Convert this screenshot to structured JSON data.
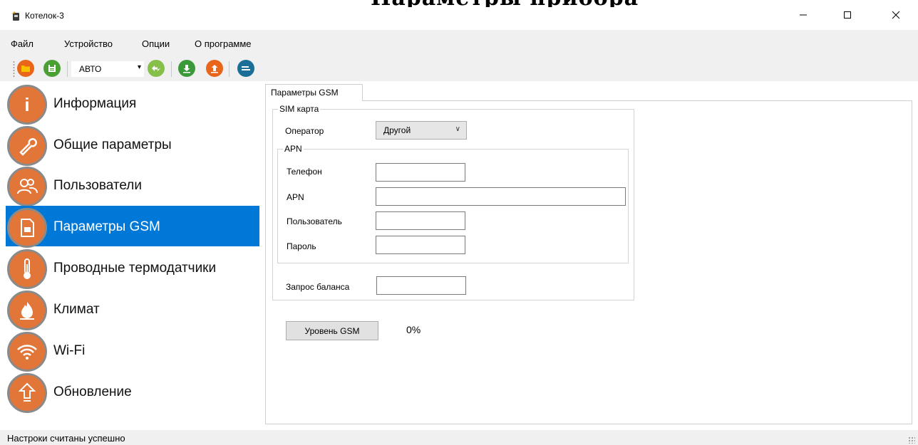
{
  "window": {
    "title": "Котелок-3",
    "overlay_title": "Параметры прибора",
    "icons": {
      "app": "boiler-icon",
      "minimize": "minimize-icon",
      "maximize": "maximize-icon",
      "close": "close-icon"
    }
  },
  "menu": [
    "Файл",
    "Устройство",
    "Опции",
    "О программе"
  ],
  "toolbar": {
    "mode_value": "АВТО",
    "icons": [
      "open-folder-icon",
      "save-icon",
      "connect-icon",
      "download-icon",
      "upload-icon",
      "sync-icon"
    ],
    "colors": {
      "orange": "#e8651a",
      "green": "#4aa033",
      "teal": "#1b6f97"
    }
  },
  "sidebar": {
    "items": [
      {
        "label": "Информация",
        "icon": "info-icon"
      },
      {
        "label": "Общие параметры",
        "icon": "wrench-icon"
      },
      {
        "label": "Пользователи",
        "icon": "users-icon"
      },
      {
        "label": "Параметры GSM",
        "icon": "sim-card-icon",
        "active": true
      },
      {
        "label": "Проводные термодатчики",
        "icon": "thermometer-icon"
      },
      {
        "label": "Климат",
        "icon": "flame-icon"
      },
      {
        "label": "Wi-Fi",
        "icon": "wifi-icon"
      },
      {
        "label": "Обновление",
        "icon": "update-arrow-icon"
      }
    ],
    "active_color": "#0078d7",
    "icon_color": "#e27538"
  },
  "tab": {
    "label": "Параметры GSM"
  },
  "gsm": {
    "sim_group": "SIM карта",
    "operator_label": "Оператор",
    "operator_value": "Другой",
    "apn_group": "APN",
    "phone_label": "Телефон",
    "phone_value": "",
    "apn_label": "APN",
    "apn_value": "",
    "user_label": "Пользователь",
    "user_value": "",
    "password_label": "Пароль",
    "password_value": "",
    "balance_label": "Запрос баланса",
    "balance_value": "",
    "signal_button": "Уровень GSM",
    "signal_value": "0%"
  },
  "status": {
    "text": "Настроки считаны успешно"
  }
}
